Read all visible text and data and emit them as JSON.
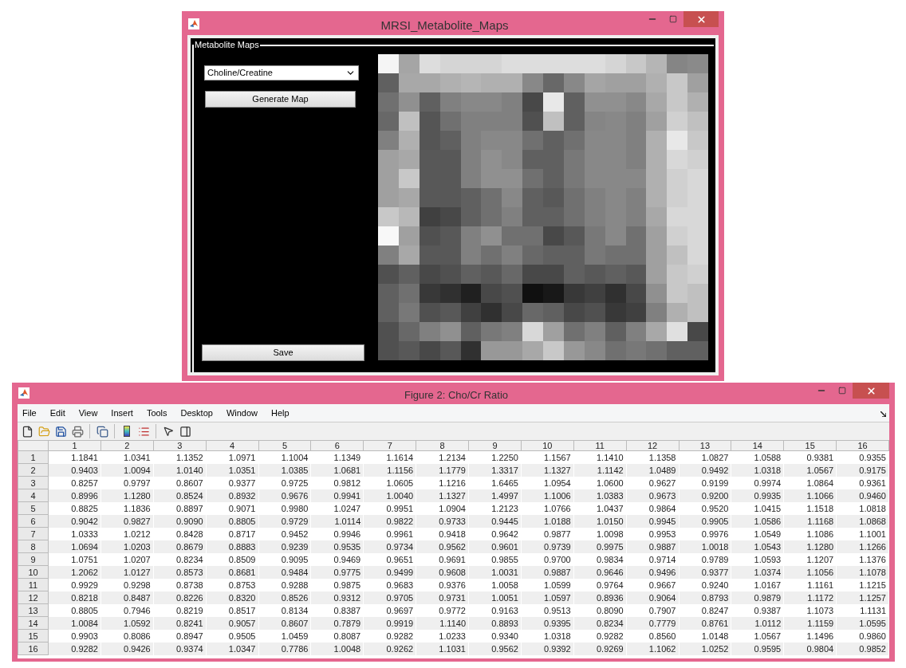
{
  "map_window": {
    "title": "MRSI_Metabolite_Maps",
    "panel_title": "Metabolite Maps",
    "metabolite_dropdown": {
      "value": "Choline/Creatine"
    },
    "generate_button": "Generate Map",
    "save_button": "Save"
  },
  "figure_window": {
    "title": "Figure 2: Cho/Cr Ratio",
    "menu": [
      "File",
      "Edit",
      "View",
      "Insert",
      "Tools",
      "Desktop",
      "Window",
      "Help"
    ],
    "table": {
      "columns": [
        "1",
        "2",
        "3",
        "4",
        "5",
        "6",
        "7",
        "8",
        "9",
        "10",
        "11",
        "12",
        "13",
        "14",
        "15",
        "16"
      ],
      "rows": [
        {
          "header": "1",
          "cells": [
            "1.1841",
            "1.0341",
            "1.1352",
            "1.0971",
            "1.1004",
            "1.1349",
            "1.1614",
            "1.2134",
            "1.2250",
            "1.1567",
            "1.1410",
            "1.1358",
            "1.0827",
            "1.0588",
            "0.9381",
            "0.9355"
          ]
        },
        {
          "header": "2",
          "cells": [
            "0.9403",
            "1.0094",
            "1.0140",
            "1.0351",
            "1.0385",
            "1.0681",
            "1.1156",
            "1.1779",
            "1.3317",
            "1.1327",
            "1.1142",
            "1.0489",
            "0.9492",
            "1.0318",
            "1.0567",
            "0.9175"
          ]
        },
        {
          "header": "3",
          "cells": [
            "0.8257",
            "0.9797",
            "0.8607",
            "0.9377",
            "0.9725",
            "0.9812",
            "1.0605",
            "1.1216",
            "1.6465",
            "1.0954",
            "1.0600",
            "0.9627",
            "0.9199",
            "0.9974",
            "1.0864",
            "0.9361"
          ]
        },
        {
          "header": "4",
          "cells": [
            "0.8996",
            "1.1280",
            "0.8524",
            "0.8932",
            "0.9676",
            "0.9941",
            "1.0040",
            "1.1327",
            "1.4997",
            "1.1006",
            "1.0383",
            "0.9673",
            "0.9200",
            "0.9935",
            "1.1066",
            "0.9460"
          ]
        },
        {
          "header": "5",
          "cells": [
            "0.8825",
            "1.1836",
            "0.8897",
            "0.9071",
            "0.9980",
            "1.0247",
            "0.9951",
            "1.0904",
            "1.2123",
            "1.0766",
            "1.0437",
            "0.9864",
            "0.9520",
            "1.0415",
            "1.1518",
            "1.0818"
          ]
        },
        {
          "header": "6",
          "cells": [
            "0.9042",
            "0.9827",
            "0.9090",
            "0.8805",
            "0.9729",
            "1.0114",
            "0.9822",
            "0.9733",
            "0.9445",
            "1.0188",
            "1.0150",
            "0.9945",
            "0.9905",
            "1.0586",
            "1.1168",
            "1.0868"
          ]
        },
        {
          "header": "7",
          "cells": [
            "1.0333",
            "1.0212",
            "0.8428",
            "0.8717",
            "0.9452",
            "0.9946",
            "0.9961",
            "0.9418",
            "0.9642",
            "0.9877",
            "1.0098",
            "0.9953",
            "0.9976",
            "1.0549",
            "1.1086",
            "1.1001"
          ]
        },
        {
          "header": "8",
          "cells": [
            "1.0694",
            "1.0203",
            "0.8679",
            "0.8883",
            "0.9239",
            "0.9535",
            "0.9734",
            "0.9562",
            "0.9601",
            "0.9739",
            "0.9975",
            "0.9887",
            "1.0018",
            "1.0543",
            "1.1280",
            "1.1266"
          ]
        },
        {
          "header": "9",
          "cells": [
            "1.0751",
            "1.0207",
            "0.8234",
            "0.8509",
            "0.9095",
            "0.9469",
            "0.9651",
            "0.9691",
            "0.9855",
            "0.9700",
            "0.9834",
            "0.9714",
            "0.9789",
            "1.0593",
            "1.1207",
            "1.1376"
          ]
        },
        {
          "header": "10",
          "cells": [
            "1.2062",
            "1.0127",
            "0.8573",
            "0.8681",
            "0.9484",
            "0.9775",
            "0.9499",
            "0.9608",
            "1.0031",
            "0.9887",
            "0.9646",
            "0.9496",
            "0.9377",
            "1.0374",
            "1.1056",
            "1.1078"
          ]
        },
        {
          "header": "11",
          "cells": [
            "0.9929",
            "0.9298",
            "0.8738",
            "0.8753",
            "0.9288",
            "0.9875",
            "0.9683",
            "0.9376",
            "1.0058",
            "1.0599",
            "0.9764",
            "0.9667",
            "0.9240",
            "1.0167",
            "1.1161",
            "1.1215"
          ]
        },
        {
          "header": "12",
          "cells": [
            "0.8218",
            "0.8487",
            "0.8226",
            "0.8320",
            "0.8526",
            "0.9312",
            "0.9705",
            "0.9731",
            "1.0051",
            "1.0597",
            "0.8936",
            "0.9064",
            "0.8793",
            "0.9879",
            "1.1172",
            "1.1257"
          ]
        },
        {
          "header": "13",
          "cells": [
            "0.8805",
            "0.7946",
            "0.8219",
            "0.8517",
            "0.8134",
            "0.8387",
            "0.9697",
            "0.9772",
            "0.9163",
            "0.9513",
            "0.8090",
            "0.7907",
            "0.8247",
            "0.9387",
            "1.1073",
            "1.1131"
          ]
        },
        {
          "header": "14",
          "cells": [
            "1.0084",
            "1.0592",
            "0.8241",
            "0.9057",
            "0.8607",
            "0.7879",
            "0.9919",
            "1.1140",
            "0.8893",
            "0.9395",
            "0.8234",
            "0.7779",
            "0.8761",
            "1.0112",
            "1.1159",
            "1.0595"
          ]
        },
        {
          "header": "15",
          "cells": [
            "0.9903",
            "0.8086",
            "0.8947",
            "0.9505",
            "1.0459",
            "0.8087",
            "0.9282",
            "1.0233",
            "0.9340",
            "1.0318",
            "0.9282",
            "0.8560",
            "1.0148",
            "1.0567",
            "1.1496",
            "0.9860"
          ]
        },
        {
          "header": "16",
          "cells": [
            "0.9282",
            "0.9426",
            "0.9374",
            "1.0347",
            "0.7786",
            "1.0048",
            "0.9262",
            "1.1031",
            "0.9562",
            "0.9392",
            "0.9269",
            "1.1062",
            "1.0252",
            "0.9595",
            "0.9804",
            "0.9852"
          ]
        }
      ]
    }
  }
}
